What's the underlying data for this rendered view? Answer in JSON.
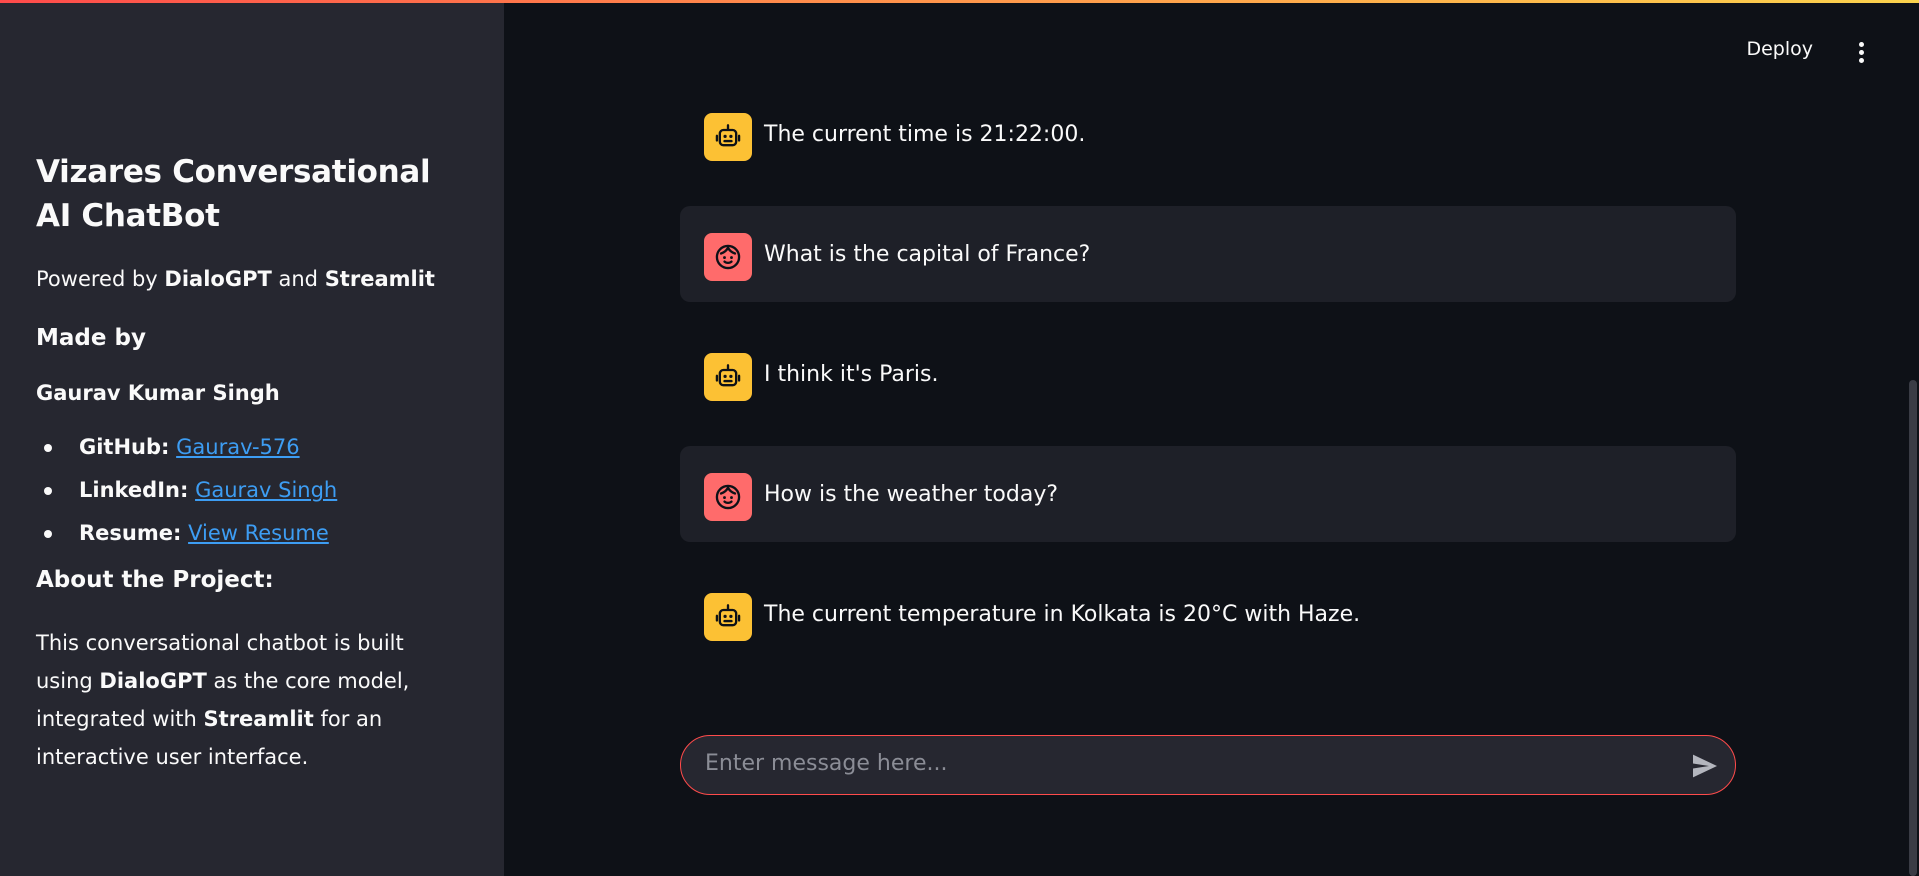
{
  "sidebar": {
    "title": "Vizares Conversational AI ChatBot",
    "powered": {
      "prefix": "Powered by",
      "model": "DialoGPT",
      "joiner": "and",
      "framework": "Streamlit"
    },
    "made_by_heading": "Made by",
    "author": "Gaurav Kumar Singh",
    "links": [
      {
        "label": "GitHub:",
        "text": "Gaurav-576"
      },
      {
        "label": "LinkedIn:",
        "text": "Gaurav Singh"
      },
      {
        "label": "Resume:",
        "text": "View Resume"
      }
    ],
    "about_heading": "About the Project:",
    "about": {
      "p1": "This conversational chatbot is built using",
      "b1": "DialoGPT",
      "p2": "as the core model, integrated with",
      "b2": "Streamlit",
      "p3": "for an interactive user interface."
    }
  },
  "header": {
    "deploy_label": "Deploy",
    "menu_icon": "kebab-menu-icon"
  },
  "messages": [
    {
      "role": "assistant",
      "icon": "robot-icon",
      "text": "The current time is 21:22:00."
    },
    {
      "role": "user",
      "icon": "face-icon",
      "text": "What is the capital of France?"
    },
    {
      "role": "assistant",
      "icon": "robot-icon",
      "text": "I think it's Paris."
    },
    {
      "role": "user",
      "icon": "face-icon",
      "text": "How is the weather today?"
    },
    {
      "role": "assistant",
      "icon": "robot-icon",
      "text": "The current temperature in Kolkata is 20°C with Haze."
    }
  ],
  "chat_input": {
    "placeholder": "Enter message here...",
    "send_icon": "send-icon"
  },
  "colors": {
    "background": "#0e1117",
    "sidebar": "#262730",
    "accent": "#ff4b4b",
    "link": "#3d9df3",
    "bot_avatar": "#fcc134",
    "user_avatar": "#ff6b6b"
  }
}
